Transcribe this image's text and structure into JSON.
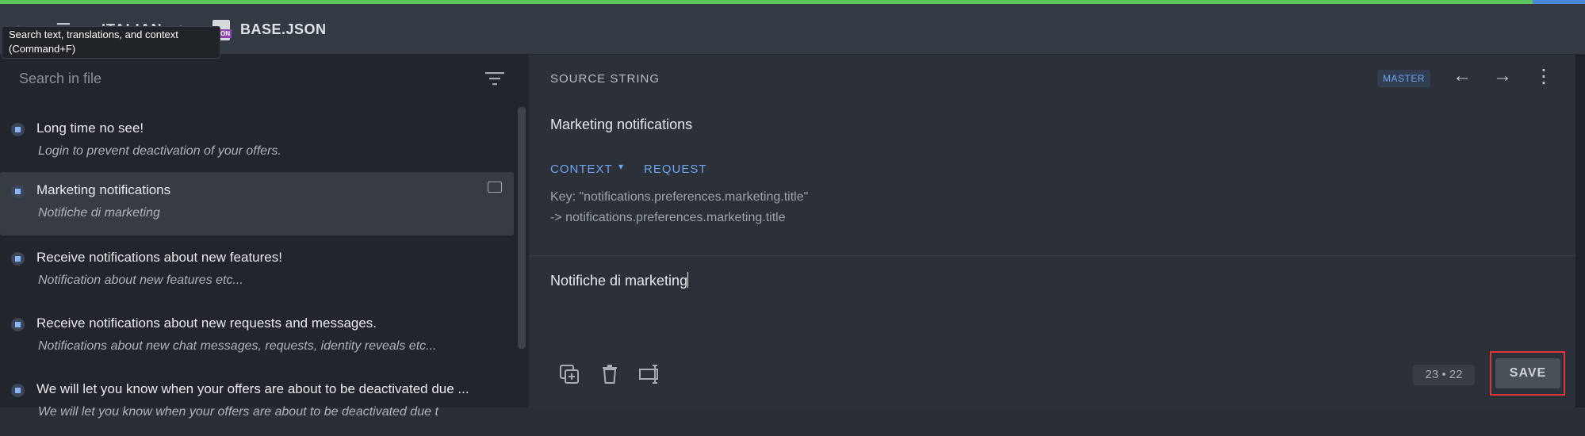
{
  "progress": {
    "percent": 96.7,
    "color": "#5cc45a"
  },
  "breadcrumb": {
    "language": "ITALIAN",
    "file_name": "BASE.JSON",
    "file_tag": "ON"
  },
  "tooltip": {
    "line1": "Search text, translations, and context",
    "line2": "(Command+F)"
  },
  "search": {
    "placeholder": "Search in file"
  },
  "strings": [
    {
      "source": "Long time no see!",
      "translation": "Login to prevent deactivation of your offers."
    },
    {
      "source": "Marketing notifications",
      "translation": "Notifiche di marketing"
    },
    {
      "source": "Receive notifications about new features!",
      "translation": "Notification about new features etc..."
    },
    {
      "source": "Receive notifications about new requests and messages.",
      "translation": "Notifications about new chat messages, requests, identity reveals etc..."
    },
    {
      "source": "We will let you know when your offers are about to be deactivated due ...",
      "translation": "We will let you know when your offers are about to be deactivated due t"
    }
  ],
  "editor": {
    "header": "SOURCE STRING",
    "badge": "MASTER",
    "source_text": "Marketing notifications",
    "context_label": "CONTEXT",
    "request_label": "REQUEST",
    "key_line1": "Key: \"notifications.preferences.marketing.title\"",
    "key_line2": "-> notifications.preferences.marketing.title",
    "translation_text": "Notifiche di marketing",
    "counter": "23 • 22",
    "save_label": "SAVE"
  },
  "icons": [
    "back-icon",
    "menu-icon",
    "file-icon",
    "filter-icon",
    "comment-icon",
    "arrow-left-icon",
    "arrow-right-icon",
    "more-vert-icon",
    "copy-source-icon",
    "delete-icon",
    "input-method-icon"
  ]
}
